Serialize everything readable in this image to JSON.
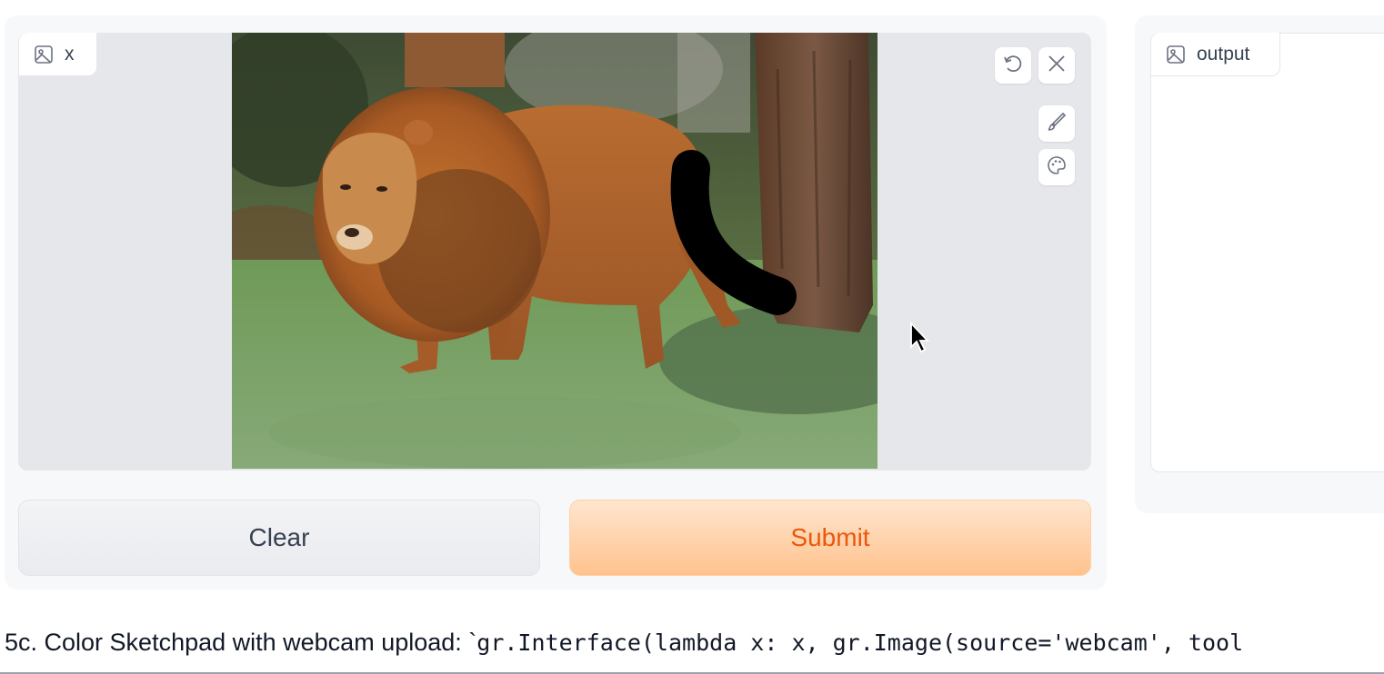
{
  "input_image": {
    "label": "x",
    "label_icon": "image-icon",
    "toolbar": {
      "undo_icon": "undo-icon",
      "clear_icon": "close-icon",
      "brush_icon": "brush-icon",
      "color_icon": "palette-icon"
    },
    "sketch_color": "#000000"
  },
  "output_image": {
    "label": "output",
    "label_icon": "image-icon"
  },
  "buttons": {
    "clear": "Clear",
    "submit": "Submit"
  },
  "caption": {
    "text": "5c. Color Sketchpad with webcam upload: `",
    "code": "gr.Interface(lambda x: x, gr.Image(source='webcam', tool"
  },
  "colors": {
    "accent": "#ea580c",
    "submit_gradient_top": "#ffe6cf",
    "submit_gradient_bottom": "#ffc28e"
  }
}
